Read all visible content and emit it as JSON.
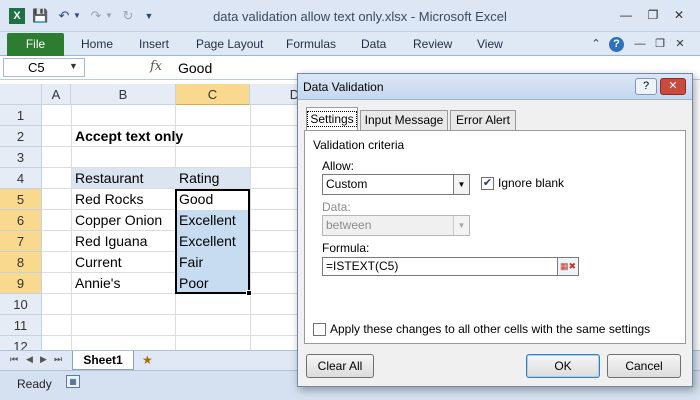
{
  "window": {
    "title": "data validation allow text only.xlsx - Microsoft Excel",
    "qat_icons": [
      "excel-icon",
      "save-icon",
      "undo-icon",
      "undo-dropdown-icon",
      "redo-icon",
      "redo-dropdown-icon",
      "repeat-icon",
      "customize-qat-icon"
    ],
    "controls": [
      "minimize-icon",
      "restore-icon",
      "close-icon"
    ]
  },
  "ribbon": {
    "file": "File",
    "tabs": [
      "Home",
      "Insert",
      "Page Layout",
      "Formulas",
      "Data",
      "Review",
      "View"
    ]
  },
  "formula_bar": {
    "name_box": "C5",
    "fx": "fx",
    "value": "Good"
  },
  "grid": {
    "columns": [
      "A",
      "B",
      "C",
      "D"
    ],
    "rows": [
      "1",
      "2",
      "3",
      "4",
      "5",
      "6",
      "7",
      "8",
      "9",
      "10",
      "11",
      "12"
    ],
    "title": "Accept text only",
    "header": {
      "restaurant": "Restaurant",
      "rating": "Rating"
    },
    "data": [
      {
        "restaurant": "Red Rocks",
        "rating": "Good"
      },
      {
        "restaurant": "Copper Onion",
        "rating": "Excellent"
      },
      {
        "restaurant": "Red Iguana",
        "rating": "Excellent"
      },
      {
        "restaurant": "Current",
        "rating": "Fair"
      },
      {
        "restaurant": "Annie's",
        "rating": "Poor"
      }
    ],
    "selected_column": "C",
    "selected_rows": [
      "5",
      "6",
      "7",
      "8",
      "9"
    ]
  },
  "sheet_tabs": {
    "active": "Sheet1",
    "nav_arrows": [
      "first-sheet-icon",
      "prev-sheet-icon",
      "next-sheet-icon",
      "last-sheet-icon"
    ]
  },
  "status_bar": {
    "status": "Ready"
  },
  "dialog": {
    "title": "Data Validation",
    "help": "?",
    "tabs": [
      "Settings",
      "Input Message",
      "Error Alert"
    ],
    "active_tab": "Settings",
    "section_title": "Validation criteria",
    "allow_label": "Allow:",
    "allow_value": "Custom",
    "ignore_blank_label": "Ignore blank",
    "ignore_blank_checked": true,
    "data_label": "Data:",
    "data_value": "between",
    "formula_label": "Formula:",
    "formula_value": "=ISTEXT(C5)",
    "apply_all_label": "Apply these changes to all other cells with the same settings",
    "apply_all_checked": false,
    "clear_all": "Clear All",
    "ok": "OK",
    "cancel": "Cancel"
  },
  "colors": {
    "file_tab": "#2c7d2f",
    "selection_fill": "#c8dcf1",
    "header_highlight": "#f9d98d",
    "table_header_fill": "#dbe5f1"
  }
}
